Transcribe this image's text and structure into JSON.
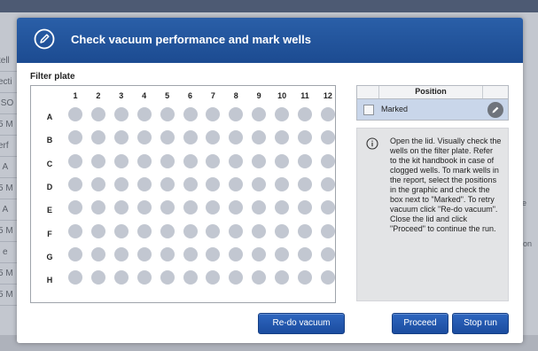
{
  "background": {
    "left_fragments": [
      "tell",
      "ecti",
      "ISO",
      "5 M",
      "erf",
      "l A",
      "5 M",
      "l A",
      "5 M",
      "l e",
      "5 M",
      "5 M"
    ],
    "right_fragments": [
      "ile",
      "pon"
    ]
  },
  "dialog": {
    "title": "Check vacuum performance and mark wells",
    "header_icon": "pencil-circle-icon"
  },
  "plate": {
    "label": "Filter plate",
    "columns": [
      "1",
      "2",
      "3",
      "4",
      "5",
      "6",
      "7",
      "8",
      "9",
      "10",
      "11",
      "12"
    ],
    "rows": [
      "A",
      "B",
      "C",
      "D",
      "E",
      "F",
      "G",
      "H"
    ],
    "well_color": "#c2c7d1"
  },
  "position_table": {
    "header": "Position",
    "row_label": "Marked",
    "row_checked": false,
    "edit_icon": "pencil-icon",
    "row_highlight": "#c9d6ea"
  },
  "info": {
    "icon": "info-icon",
    "text": "Open the lid. Visually check the wells on the filter plate. Refer to the kit handbook in case of clogged wells. To mark wells in the report, select the positions in the graphic and check the box next to \"Marked\". To retry vacuum click \"Re-do vacuum\".  Close the lid and click \"Proceed\" to continue the run."
  },
  "buttons": {
    "redo": "Re-do vacuum",
    "proceed": "Proceed",
    "stop": "Stop run"
  },
  "colors": {
    "header": "#2a5fa8",
    "button": "#2e66bf"
  }
}
